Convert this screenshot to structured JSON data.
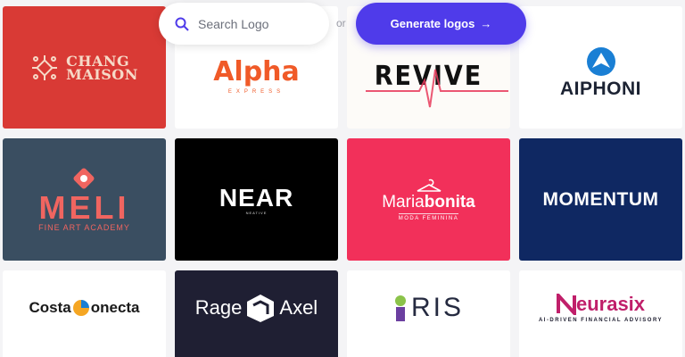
{
  "search": {
    "placeholder": "Search Logo"
  },
  "or_text": "or",
  "generate_button": {
    "label": "Generate logos",
    "arrow": "→"
  },
  "logos": {
    "chang_maison": {
      "line1": "CHANG",
      "line2": "MAISON",
      "bg": "#d93a35"
    },
    "alpha": {
      "name": "Alpha",
      "sub": "EXPRESS",
      "bg": "#ffffff"
    },
    "revive": {
      "name": "REVIVE",
      "bg": "#fdfbf8"
    },
    "aiphoni": {
      "name": "AIPHONI",
      "bg": "#ffffff"
    },
    "meli": {
      "name": "MELI",
      "sub": "FINE ART ACADEMY",
      "bg": "#3a4e61"
    },
    "near": {
      "name": "NEAR",
      "sub": "NEATIVE",
      "bg": "#000000"
    },
    "mariabonita": {
      "part1": "Maria",
      "part2": "bonita",
      "sub": "MODA FEMININA",
      "bg": "#f2305a"
    },
    "momentum": {
      "name": "MOMENTUM",
      "bg": "#0f2862"
    },
    "costaconecta": {
      "part1": "Costa",
      "part2": "onecta",
      "bg": "#ffffff"
    },
    "rageaxel": {
      "part1": "Rage",
      "part2": "Axel",
      "bg": "#1f1f33"
    },
    "ris": {
      "name": "RIS",
      "bg": "#ffffff"
    },
    "neurasix": {
      "name": "eurasix",
      "sub": "AI-DRIVEN FINANCIAL ADVISORY",
      "bg": "#ffffff"
    }
  }
}
